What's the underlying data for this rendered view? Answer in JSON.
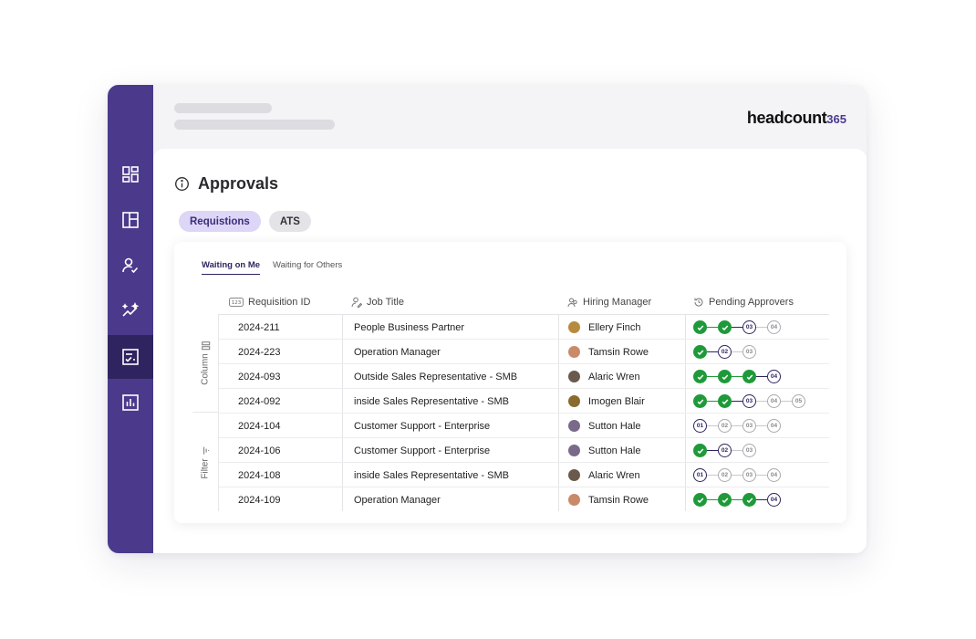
{
  "brand": {
    "name": "headcount",
    "suffix": "365",
    "accent": "#4b3a8c"
  },
  "sidebar": {
    "items": [
      {
        "name": "dashboard",
        "icon": "dashboard-grid-icon",
        "active": false
      },
      {
        "name": "layout",
        "icon": "layout-panels-icon",
        "active": false
      },
      {
        "name": "user-approve",
        "icon": "user-check-icon",
        "active": false
      },
      {
        "name": "insights",
        "icon": "sparkle-trend-icon",
        "active": false
      },
      {
        "name": "approvals",
        "icon": "checklist-icon",
        "active": true
      },
      {
        "name": "reports",
        "icon": "bar-chart-icon",
        "active": false
      }
    ]
  },
  "page": {
    "title": "Approvals",
    "info_icon": "info-icon"
  },
  "pills": [
    {
      "label": "Requistions",
      "active": true
    },
    {
      "label": "ATS",
      "active": false
    }
  ],
  "subtabs": [
    {
      "label": "Waiting on Me",
      "active": true
    },
    {
      "label": "Waiting for Others",
      "active": false
    }
  ],
  "side_tools": {
    "column": "Column",
    "filter": "Filter"
  },
  "table": {
    "columns": [
      {
        "label": "Requisition ID",
        "icon": "number-icon"
      },
      {
        "label": "Job Title",
        "icon": "person-edit-icon"
      },
      {
        "label": "Hiring Manager",
        "icon": "people-icon"
      },
      {
        "label": "Pending Approvers",
        "icon": "history-icon"
      }
    ],
    "rows": [
      {
        "id": "2024-211",
        "title": "People Business Partner",
        "manager": "Ellery Finch",
        "avatar": "#b88a3e",
        "steps": [
          {
            "s": "done",
            "l": ""
          },
          {
            "s": "done",
            "l": ""
          },
          {
            "s": "current",
            "l": "03"
          },
          {
            "s": "pending",
            "l": "04"
          }
        ]
      },
      {
        "id": "2024-223",
        "title": "Operation Manager",
        "manager": "Tamsin Rowe",
        "avatar": "#c98a6a",
        "steps": [
          {
            "s": "done",
            "l": ""
          },
          {
            "s": "current",
            "l": "02"
          },
          {
            "s": "pending",
            "l": "03"
          }
        ]
      },
      {
        "id": "2024-093",
        "title": "Outside Sales Representative - SMB",
        "manager": "Alaric Wren",
        "avatar": "#6a5a4e",
        "steps": [
          {
            "s": "done",
            "l": ""
          },
          {
            "s": "done",
            "l": ""
          },
          {
            "s": "done",
            "l": ""
          },
          {
            "s": "current",
            "l": "04"
          }
        ]
      },
      {
        "id": "2024-092",
        "title": "inside Sales Representative - SMB",
        "manager": "Imogen Blair",
        "avatar": "#8a6a2e",
        "steps": [
          {
            "s": "done",
            "l": ""
          },
          {
            "s": "done",
            "l": ""
          },
          {
            "s": "current",
            "l": "03"
          },
          {
            "s": "pending",
            "l": "04"
          },
          {
            "s": "pending",
            "l": "05"
          }
        ]
      },
      {
        "id": "2024-104",
        "title": "Customer Support - Enterprise",
        "manager": "Sutton Hale",
        "avatar": "#7a6a8a",
        "steps": [
          {
            "s": "current",
            "l": "01"
          },
          {
            "s": "pending",
            "l": "02"
          },
          {
            "s": "pending",
            "l": "03"
          },
          {
            "s": "pending",
            "l": "04"
          }
        ]
      },
      {
        "id": "2024-106",
        "title": "Customer Support - Enterprise",
        "manager": "Sutton Hale",
        "avatar": "#7a6a8a",
        "steps": [
          {
            "s": "done",
            "l": ""
          },
          {
            "s": "current",
            "l": "02"
          },
          {
            "s": "pending",
            "l": "03"
          }
        ]
      },
      {
        "id": "2024-108",
        "title": "inside Sales Representative - SMB",
        "manager": "Alaric Wren",
        "avatar": "#6a5a4e",
        "steps": [
          {
            "s": "current",
            "l": "01"
          },
          {
            "s": "pending",
            "l": "02"
          },
          {
            "s": "pending",
            "l": "03"
          },
          {
            "s": "pending",
            "l": "04"
          }
        ]
      },
      {
        "id": "2024-109",
        "title": "Operation Manager",
        "manager": "Tamsin Rowe",
        "avatar": "#c98a6a",
        "steps": [
          {
            "s": "done",
            "l": ""
          },
          {
            "s": "done",
            "l": ""
          },
          {
            "s": "done",
            "l": ""
          },
          {
            "s": "current",
            "l": "04"
          }
        ]
      }
    ]
  },
  "colors": {
    "done": "#1f9a3a",
    "current": "#2f2460",
    "pending": "#a9a9b0",
    "pill_active_bg": "#ddd6f7"
  }
}
